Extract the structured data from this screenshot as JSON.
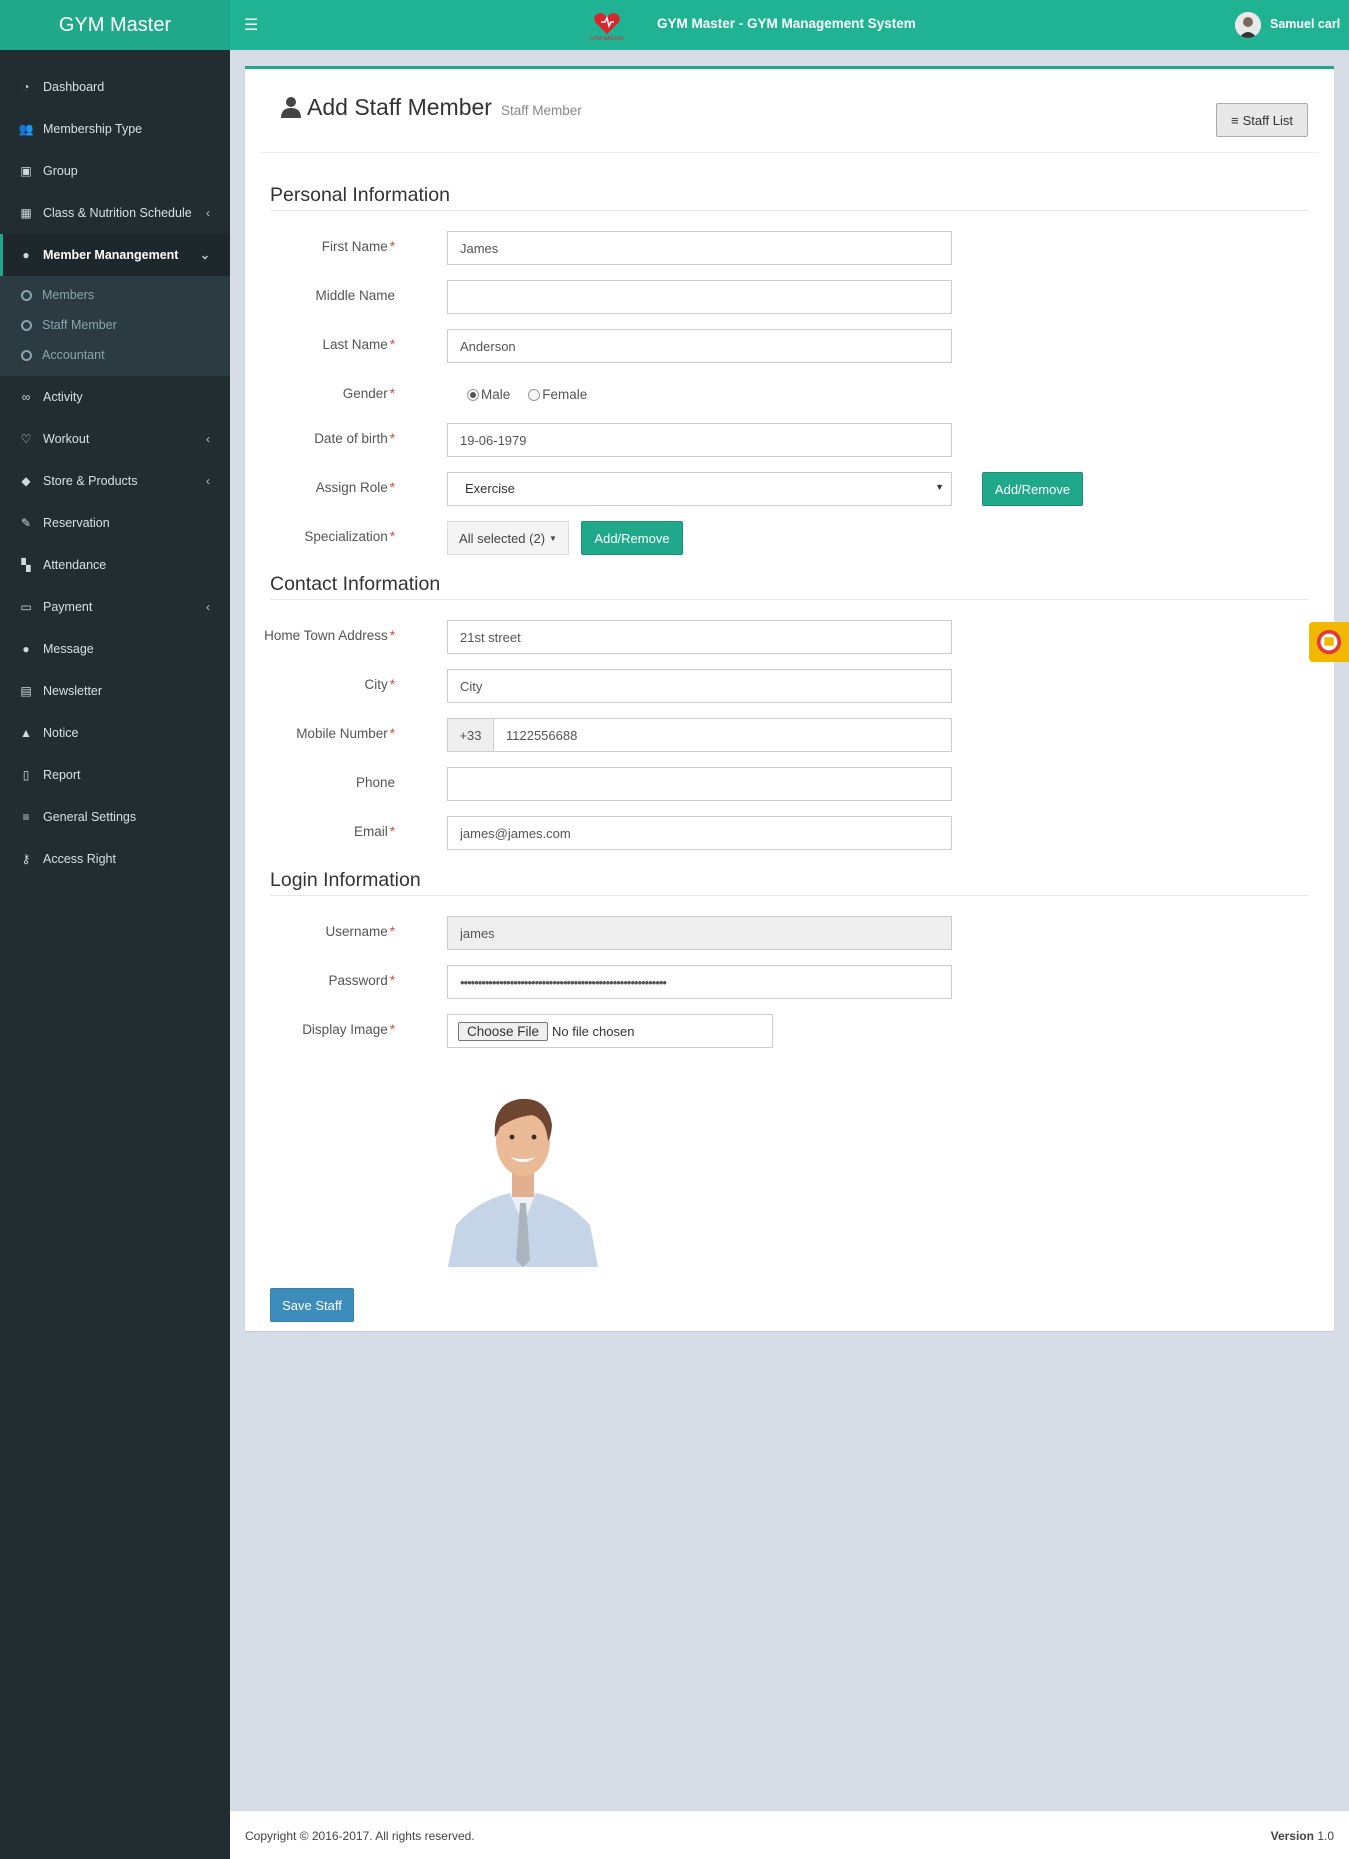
{
  "app": {
    "logo_text": "GYM Master",
    "system_title": "GYM Master - GYM Management System",
    "user_name": "Samuel carl",
    "brand_small_text": "GYM MASTER"
  },
  "sidebar": {
    "items": [
      {
        "label": "Dashboard",
        "icon": "dashboard-icon"
      },
      {
        "label": "Membership Type",
        "icon": "users-icon"
      },
      {
        "label": "Group",
        "icon": "group-icon"
      },
      {
        "label": "Class & Nutrition Schedule",
        "icon": "calendar-icon"
      },
      {
        "label": "Member Manangement",
        "icon": "user-icon"
      },
      {
        "label": "Activity",
        "icon": "bicycle-icon"
      },
      {
        "label": "Workout",
        "icon": "heart-icon"
      },
      {
        "label": "Store & Products",
        "icon": "tags-icon"
      },
      {
        "label": "Reservation",
        "icon": "ticket-icon"
      },
      {
        "label": "Attendance",
        "icon": "attendance-icon"
      },
      {
        "label": "Payment",
        "icon": "money-icon"
      },
      {
        "label": "Message",
        "icon": "comment-icon"
      },
      {
        "label": "Newsletter",
        "icon": "newsletter-icon"
      },
      {
        "label": "Notice",
        "icon": "bell-icon"
      },
      {
        "label": "Report",
        "icon": "report-icon"
      },
      {
        "label": "General Settings",
        "icon": "sliders-icon"
      },
      {
        "label": "Access Right",
        "icon": "key-icon"
      }
    ],
    "submenu": [
      "Members",
      "Staff Member",
      "Accountant"
    ]
  },
  "page": {
    "title": "Add Staff Member",
    "subtitle": "Staff Member",
    "staff_list_label": "Staff List"
  },
  "sections": {
    "personal": "Personal Information",
    "contact": "Contact Information",
    "login": "Login Information"
  },
  "form": {
    "first_name": {
      "label": "First Name",
      "value": "James"
    },
    "middle_name": {
      "label": "Middle Name",
      "value": ""
    },
    "last_name": {
      "label": "Last Name",
      "value": "Anderson"
    },
    "gender": {
      "label": "Gender",
      "options": [
        "Male",
        "Female"
      ],
      "selected": "Male"
    },
    "dob": {
      "label": "Date of birth",
      "value": "19-06-1979"
    },
    "role": {
      "label": "Assign Role",
      "value": "Exercise",
      "button": "Add/Remove"
    },
    "specialization": {
      "label": "Specialization",
      "value": "All selected (2)",
      "button": "Add/Remove"
    },
    "address": {
      "label": "Home Town Address",
      "value": "21st street"
    },
    "city": {
      "label": "City",
      "value": "City"
    },
    "mobile": {
      "label": "Mobile Number",
      "prefix": "+33",
      "value": "1122556688"
    },
    "phone": {
      "label": "Phone",
      "value": ""
    },
    "email": {
      "label": "Email",
      "value": "james@james.com"
    },
    "username": {
      "label": "Username",
      "value": "james"
    },
    "password": {
      "label": "Password",
      "value": "••••••••••••••••••••••••••••••••••••••••••••••••••••••••••"
    },
    "display_image": {
      "label": "Display Image",
      "button": "Choose File",
      "status": "No file chosen"
    },
    "save_label": "Save Staff"
  },
  "footer": {
    "copyright": "Copyright © 2016-2017. All rights reserved.",
    "version_label": "Version",
    "version_value": "1.0"
  },
  "colors": {
    "brand": "#1fb394",
    "sidebar": "#222d32",
    "save": "#3c8dbc"
  }
}
